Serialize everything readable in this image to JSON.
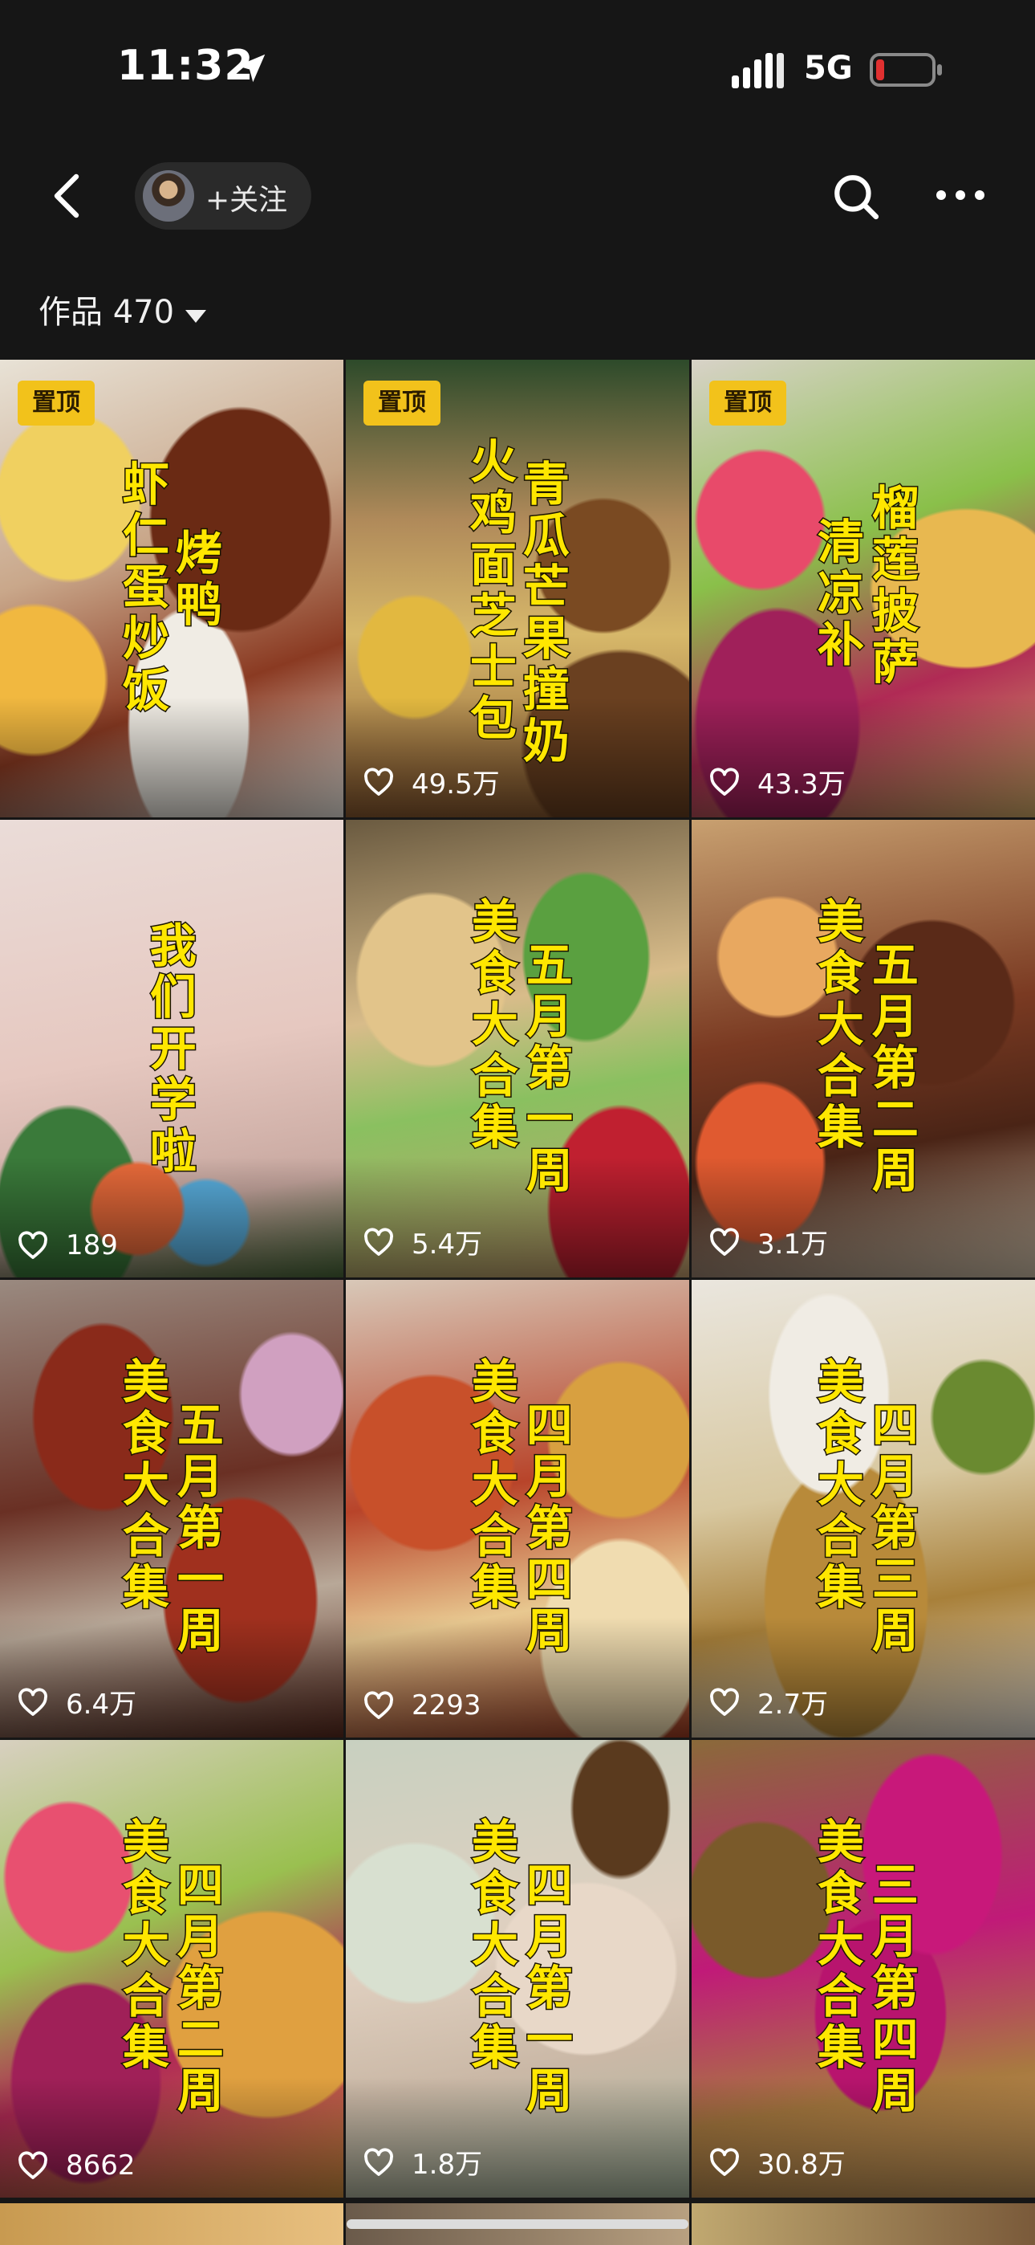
{
  "status_bar": {
    "time": "11:32",
    "network": "5G",
    "battery_color": "#e03030"
  },
  "nav": {
    "follow_label": "+关注",
    "accent": "#f2c21b"
  },
  "works": {
    "label": "作品 470"
  },
  "pin_label": "置顶",
  "tiles": [
    {
      "pinned": true,
      "caption_cols": [
        "烤鸭",
        "虾仁蛋炒饭"
      ],
      "likes": ""
    },
    {
      "pinned": true,
      "caption_cols": [
        "青瓜芒果撞奶",
        "火鸡面芝士包"
      ],
      "likes": "49.5万"
    },
    {
      "pinned": true,
      "caption_cols": [
        "榴莲披萨",
        "清凉补"
      ],
      "likes": "43.3万"
    },
    {
      "pinned": false,
      "caption_cols": [
        "我们开学啦"
      ],
      "likes": "189"
    },
    {
      "pinned": false,
      "caption_cols": [
        "五月第一周",
        "美食大合集"
      ],
      "likes": "5.4万"
    },
    {
      "pinned": false,
      "caption_cols": [
        "五月第二周",
        "美食大合集"
      ],
      "likes": "3.1万"
    },
    {
      "pinned": false,
      "caption_cols": [
        "五月第一周",
        "美食大合集"
      ],
      "likes": "6.4万"
    },
    {
      "pinned": false,
      "caption_cols": [
        "四月第四周",
        "美食大合集"
      ],
      "likes": "2293"
    },
    {
      "pinned": false,
      "caption_cols": [
        "四月第三周",
        "美食大合集"
      ],
      "likes": "2.7万"
    },
    {
      "pinned": false,
      "caption_cols": [
        "四月第二周",
        "美食大合集"
      ],
      "likes": "8662"
    },
    {
      "pinned": false,
      "caption_cols": [
        "四月第一周",
        "美食大合集"
      ],
      "likes": "1.8万"
    },
    {
      "pinned": false,
      "caption_cols": [
        "三月第四周",
        "美食大合集"
      ],
      "likes": "30.8万"
    }
  ]
}
